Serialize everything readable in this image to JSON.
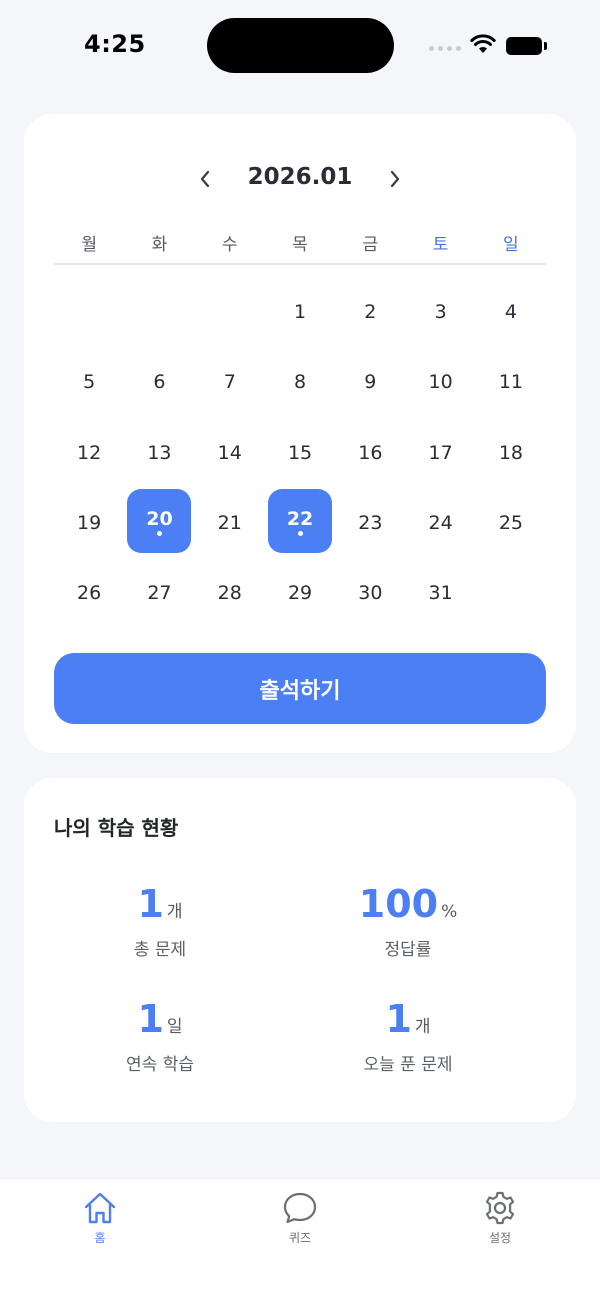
{
  "status_bar": {
    "time": "4:25"
  },
  "calendar": {
    "title": "2026.01",
    "weekdays": [
      "월",
      "화",
      "수",
      "목",
      "금",
      "토",
      "일"
    ],
    "days": [
      "",
      "",
      "",
      "1",
      "2",
      "3",
      "4",
      "5",
      "6",
      "7",
      "8",
      "9",
      "10",
      "11",
      "12",
      "13",
      "14",
      "15",
      "16",
      "17",
      "18",
      "19",
      "20",
      "21",
      "22",
      "23",
      "24",
      "25",
      "26",
      "27",
      "28",
      "29",
      "30",
      "31",
      ""
    ],
    "attended_days": [
      "20",
      "22"
    ],
    "accent_color": "#4c7ef4",
    "weekend_color": "#4a72d9"
  },
  "attend_button": {
    "label": "출석하기"
  },
  "stats": {
    "title": "나의 학습 현황",
    "items": [
      {
        "value": "1",
        "unit": "개",
        "label": "총 문제"
      },
      {
        "value": "100",
        "unit": "%",
        "label": "정답률"
      },
      {
        "value": "1",
        "unit": "일",
        "label": "연속 학습"
      },
      {
        "value": "1",
        "unit": "개",
        "label": "오늘 푼 문제"
      }
    ]
  },
  "tabs": [
    {
      "label": "홈",
      "icon": "home-icon",
      "active": true
    },
    {
      "label": "퀴즈",
      "icon": "chat-bubble-icon",
      "active": false
    },
    {
      "label": "설정",
      "icon": "gear-icon",
      "active": false
    }
  ]
}
